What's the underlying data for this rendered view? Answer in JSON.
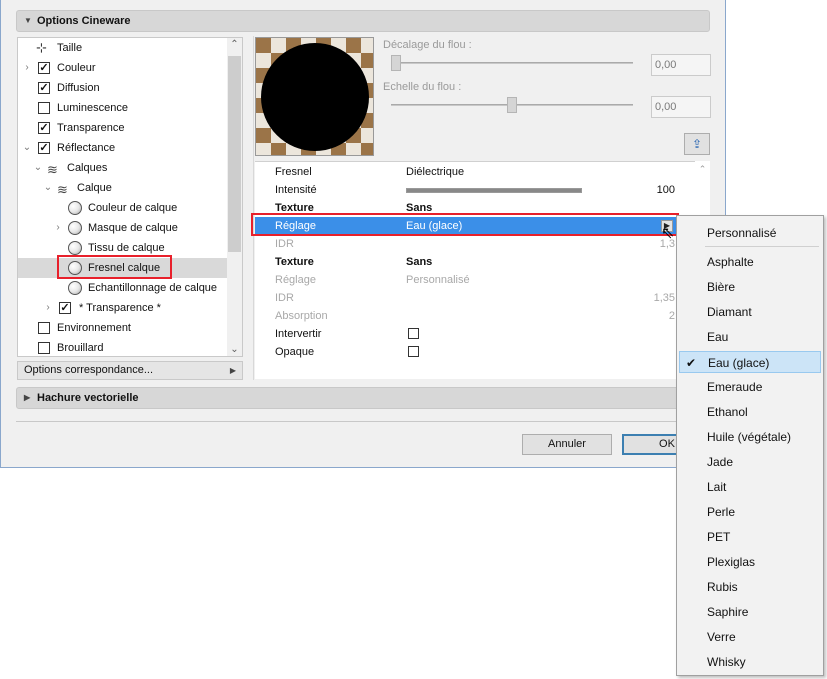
{
  "sections": {
    "cineware": "Options Cineware",
    "hatch": "Hachure vectorielle"
  },
  "tree": {
    "items": [
      {
        "label": "Taille",
        "icon": "resize-icon"
      },
      {
        "label": "Couleur",
        "checked": true
      },
      {
        "label": "Diffusion",
        "checked": true
      },
      {
        "label": "Luminescence",
        "checked": false
      },
      {
        "label": "Transparence",
        "checked": true
      },
      {
        "label": "Réflectance",
        "checked": true
      },
      {
        "label": "Calques",
        "icon": "layers-icon"
      },
      {
        "label": "Calque",
        "icon": "layers-icon"
      },
      {
        "label": "Couleur de calque",
        "icon": "sphere-icon"
      },
      {
        "label": "Masque de calque",
        "icon": "sphere-icon"
      },
      {
        "label": "Tissu de calque",
        "icon": "sphere-icon"
      },
      {
        "label": "Fresnel calque",
        "icon": "sphere-icon",
        "selected": true
      },
      {
        "label": "Echantillonnage de calque",
        "icon": "sphere-icon"
      },
      {
        "label": "* Transparence *",
        "checked": true
      },
      {
        "label": "Environnement",
        "checked": false
      },
      {
        "label": "Brouillard",
        "checked": false
      }
    ],
    "check_glyph": "✓"
  },
  "options_button": "Options correspondance...",
  "sliders": {
    "blur_offset": {
      "label": "Décalage du flou :",
      "value": "0,00"
    },
    "blur_scale": {
      "label": "Echelle du flou :",
      "value": "0,00"
    }
  },
  "properties": {
    "fresnel": {
      "key": "Fresnel",
      "value": "Diélectrique"
    },
    "intensity": {
      "key": "Intensité",
      "value": "100",
      "level_percent": 100
    },
    "texture1": {
      "key": "Texture",
      "value": "Sans"
    },
    "preset": {
      "key": "Réglage",
      "value": "Eau (glace)"
    },
    "idr1": {
      "key": "IDR",
      "value": "1,3"
    },
    "texture2": {
      "key": "Texture",
      "value": "Sans"
    },
    "preset2": {
      "key": "Réglage",
      "value": "Personnalisé"
    },
    "idr2": {
      "key": "IDR",
      "value": "1,35"
    },
    "absorption": {
      "key": "Absorption",
      "value": "2"
    },
    "invert": {
      "key": "Intervertir",
      "checked": false
    },
    "opaque": {
      "key": "Opaque",
      "checked": false
    }
  },
  "buttons": {
    "cancel": "Annuler",
    "ok": "OK"
  },
  "dropdown": {
    "header": "Personnalisé",
    "items": [
      "Asphalte",
      "Bière",
      "Diamant",
      "Eau",
      "Eau (glace)",
      "Emeraude",
      "Ethanol",
      "Huile (végétale)",
      "Jade",
      "Lait",
      "Perle",
      "PET",
      "Plexiglas",
      "Rubis",
      "Saphire",
      "Verre",
      "Whisky"
    ],
    "selected": "Eau (glace)"
  },
  "colors": {
    "selection_blue": "#3b8fe8",
    "highlight_red": "#e8202b",
    "menu_check_bg": "#cce4f7"
  }
}
